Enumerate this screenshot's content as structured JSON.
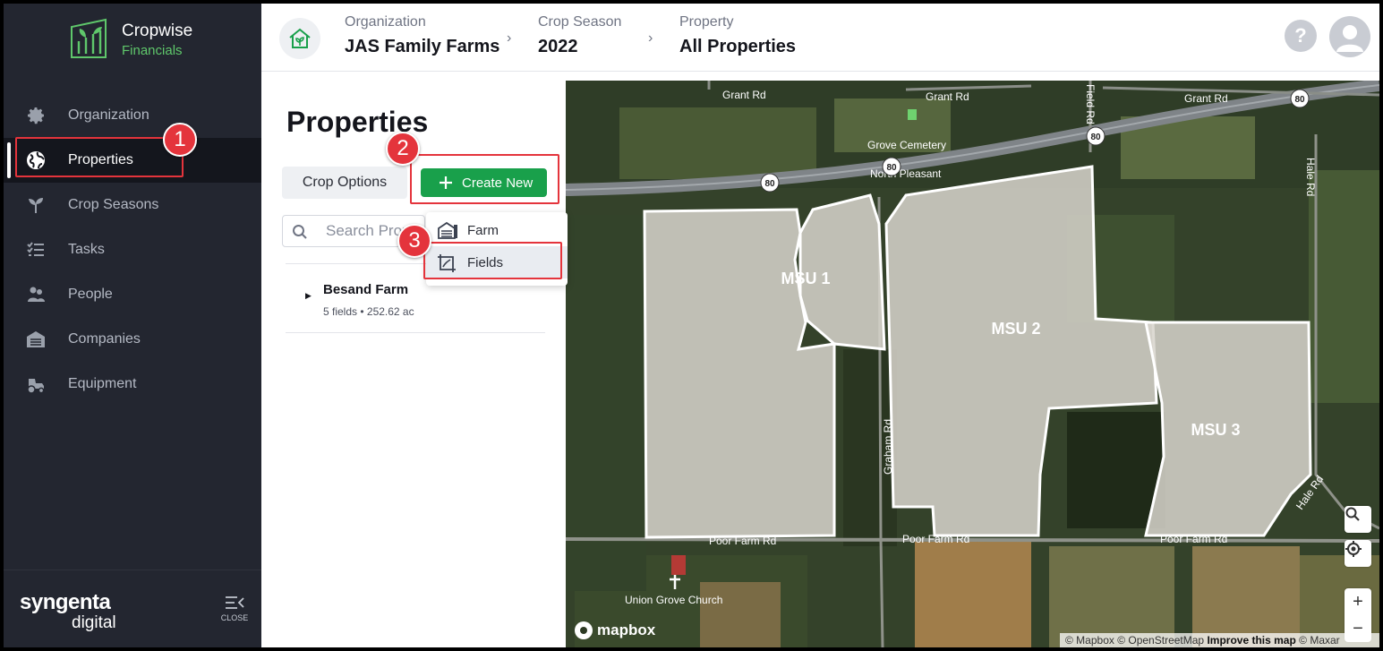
{
  "app": {
    "brand_line1": "Cropwise",
    "brand_line2": "Financials"
  },
  "sidebar": {
    "items": [
      {
        "label": "Organization",
        "icon": "gear-icon",
        "active": false
      },
      {
        "label": "Properties",
        "icon": "globe-icon",
        "active": true
      },
      {
        "label": "Crop Seasons",
        "icon": "sprout-icon",
        "active": false
      },
      {
        "label": "Tasks",
        "icon": "checklist-icon",
        "active": false
      },
      {
        "label": "People",
        "icon": "people-icon",
        "active": false
      },
      {
        "label": "Companies",
        "icon": "warehouse-icon",
        "active": false
      },
      {
        "label": "Equipment",
        "icon": "tractor-icon",
        "active": false
      }
    ],
    "footer": {
      "logo_line1": "syngenta",
      "logo_line2": "digital",
      "close_label": "CLOSE"
    }
  },
  "header": {
    "breadcrumbs": [
      {
        "label": "Organization",
        "value": "JAS Family Farms"
      },
      {
        "label": "Crop Season",
        "value": "2022"
      },
      {
        "label": "Property",
        "value": "All Properties"
      }
    ],
    "help_label": "?"
  },
  "panel": {
    "title": "Properties",
    "crop_options_label": "Crop Options",
    "create_new_label": "Create New",
    "search_placeholder": "Search Properties",
    "farms": [
      {
        "name": "Besand Farm",
        "meta": "5 fields • 252.62 ac"
      }
    ]
  },
  "dropdown": {
    "items": [
      {
        "label": "Farm",
        "icon": "farm-icon"
      },
      {
        "label": "Fields",
        "icon": "field-icon"
      }
    ]
  },
  "map": {
    "fields": [
      "MSU 1",
      "MSU 2",
      "MSU 3"
    ],
    "roads": {
      "grant1": "Grant Rd",
      "grant2": "Grant Rd",
      "grant3": "Grant Rd",
      "poor1": "Poor Farm Rd",
      "poor2": "Poor Farm Rd",
      "poor3": "Poor Farm Rd",
      "hale1": "Hale Rd",
      "hale2": "Hale Rd",
      "graham": "Graham Rd",
      "field": "Field Rd",
      "hw80": "80"
    },
    "places": {
      "cemetery1": "North Pleasant",
      "cemetery2": "Grove Cemetery",
      "church": "Union Grove Church"
    },
    "logo_text": "mapbox",
    "attribution_1": "© Mapbox © OpenStreetMap",
    "attribution_2": "Improve this map",
    "attribution_3": "© Maxar",
    "zoom_in": "+",
    "zoom_out": "−"
  },
  "annotations": {
    "step1": "1",
    "step2": "2",
    "step3": "3"
  },
  "colors": {
    "brand_green": "#19a04b",
    "sidebar_bg": "#232630",
    "callout_red": "#e4343c"
  }
}
